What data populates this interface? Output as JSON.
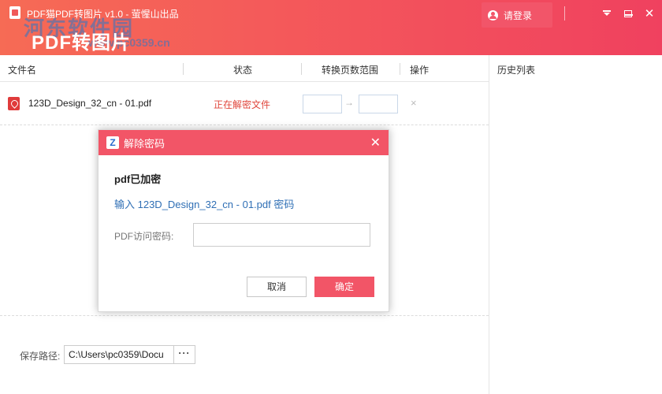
{
  "header": {
    "app_title": "PDF猫PDF转图片 v1.0 - 萤惺山出品",
    "banner_title": "PDF转图片",
    "watermark": "河东软件园",
    "watermark_url": "www.pc0359.cn",
    "login_label": "请登录",
    "accent_color": "#f25567"
  },
  "table": {
    "columns": [
      "文件名",
      "状态",
      "转换页数范围",
      "操作"
    ],
    "rows": [
      {
        "file_name": "123D_Design_32_cn - 01.pdf",
        "status": "正在解密文件",
        "page_from": "",
        "page_to": "",
        "arrow": "→",
        "remove": "×"
      }
    ]
  },
  "right_panel": {
    "title": "历史列表"
  },
  "footer": {
    "save_label": "保存路径:",
    "save_path": "C:\\Users\\pc0359\\Docu",
    "browse_label": "···"
  },
  "dialog": {
    "icon_letter": "Z",
    "title": "解除密码",
    "heading": "pdf已加密",
    "message": "输入 123D_Design_32_cn - 01.pdf 密码",
    "password_label": "PDF访问密码:",
    "password_value": "",
    "cancel_label": "取消",
    "ok_label": "确定"
  }
}
